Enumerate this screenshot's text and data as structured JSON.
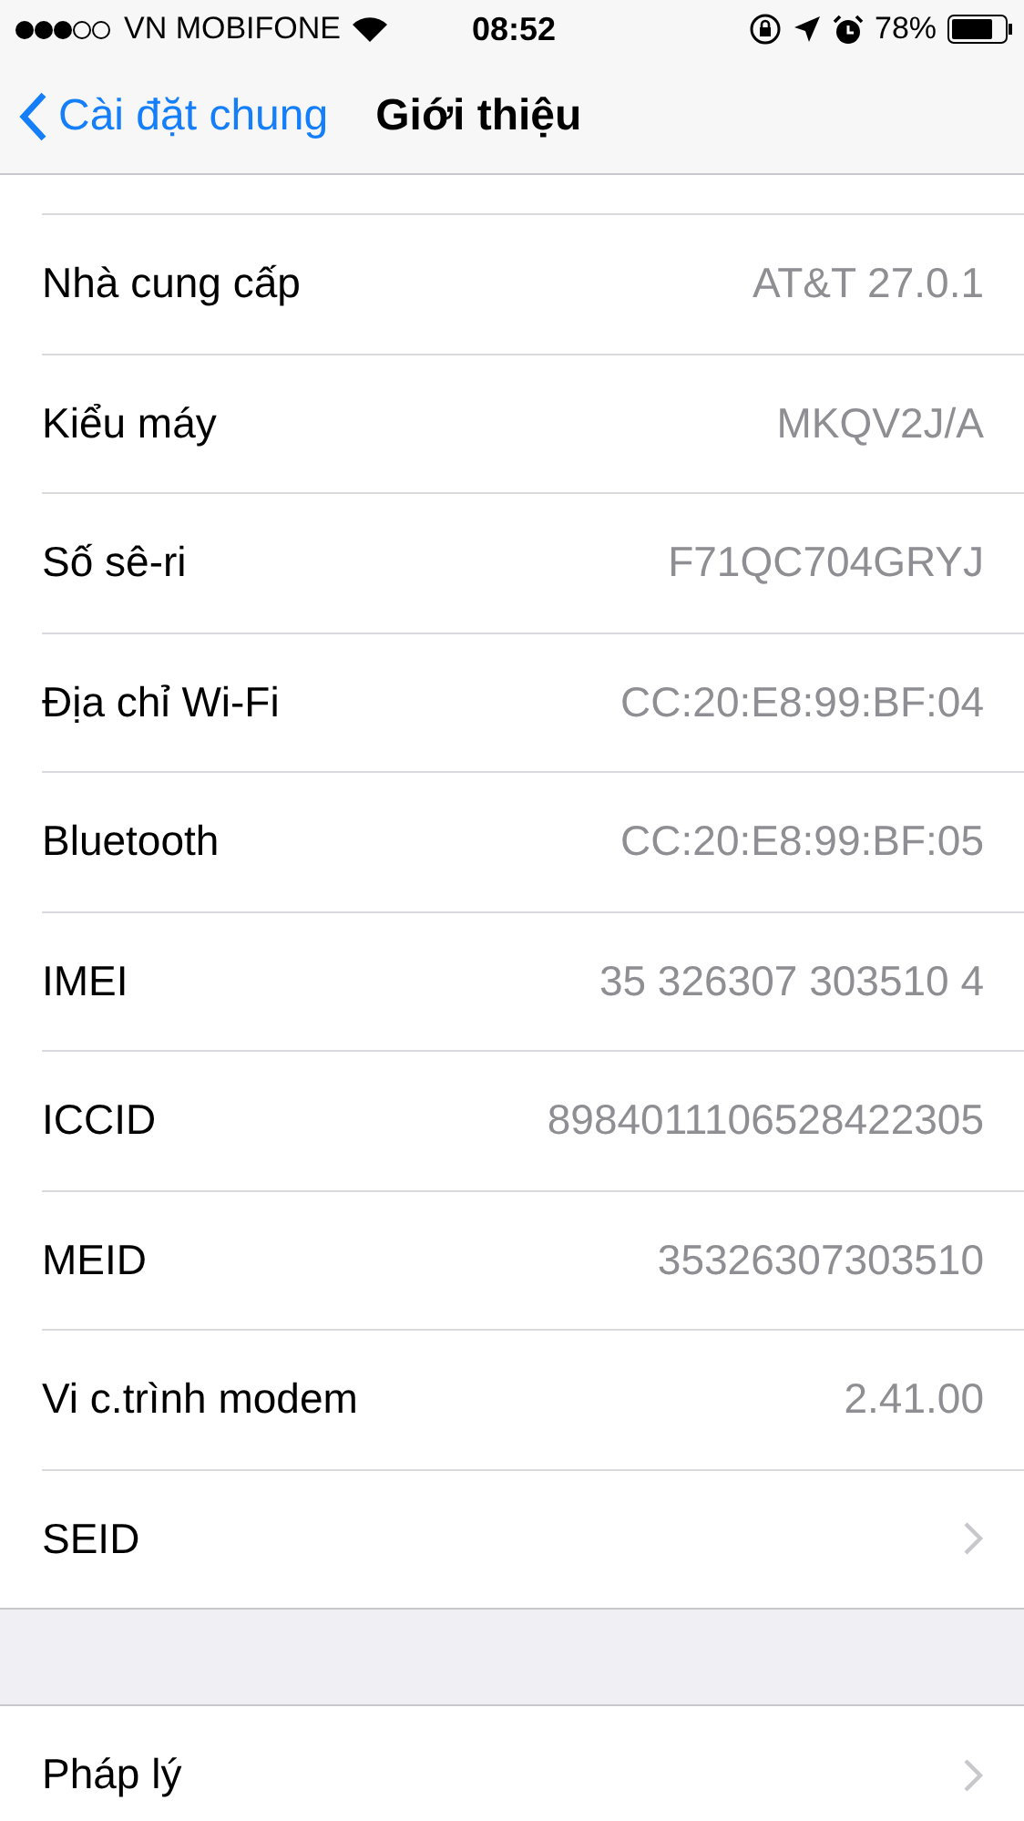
{
  "status_bar": {
    "carrier": "VN MOBIFONE",
    "time": "08:52",
    "battery": "78%"
  },
  "nav_bar": {
    "back": "Cài đặt chung",
    "title": "Giới thiệu"
  },
  "sections": [
    {
      "rows": [
        {
          "kind": "value",
          "label": "Nhà cung cấp",
          "value": "AT&T 27.0.1"
        },
        {
          "kind": "value",
          "label": "Kiểu máy",
          "value": "MKQV2J/A"
        },
        {
          "kind": "value",
          "label": "Số sê-ri",
          "value": "F71QC704GRYJ"
        },
        {
          "kind": "value",
          "label": "Địa chỉ Wi-Fi",
          "value": "CC:20:E8:99:BF:04"
        },
        {
          "kind": "value",
          "label": "Bluetooth",
          "value": "CC:20:E8:99:BF:05"
        },
        {
          "kind": "value",
          "label": "IMEI",
          "value": "35 326307 303510 4"
        },
        {
          "kind": "value",
          "label": "ICCID",
          "value": "8984011106528422305"
        },
        {
          "kind": "value",
          "label": "MEID",
          "value": "35326307303510"
        },
        {
          "kind": "value",
          "label": "Vi c.trình modem",
          "value": "2.41.00"
        },
        {
          "kind": "disclosure",
          "label": "SEID"
        }
      ]
    },
    {
      "rows": [
        {
          "kind": "disclosure",
          "label": "Pháp lý"
        }
      ]
    }
  ]
}
